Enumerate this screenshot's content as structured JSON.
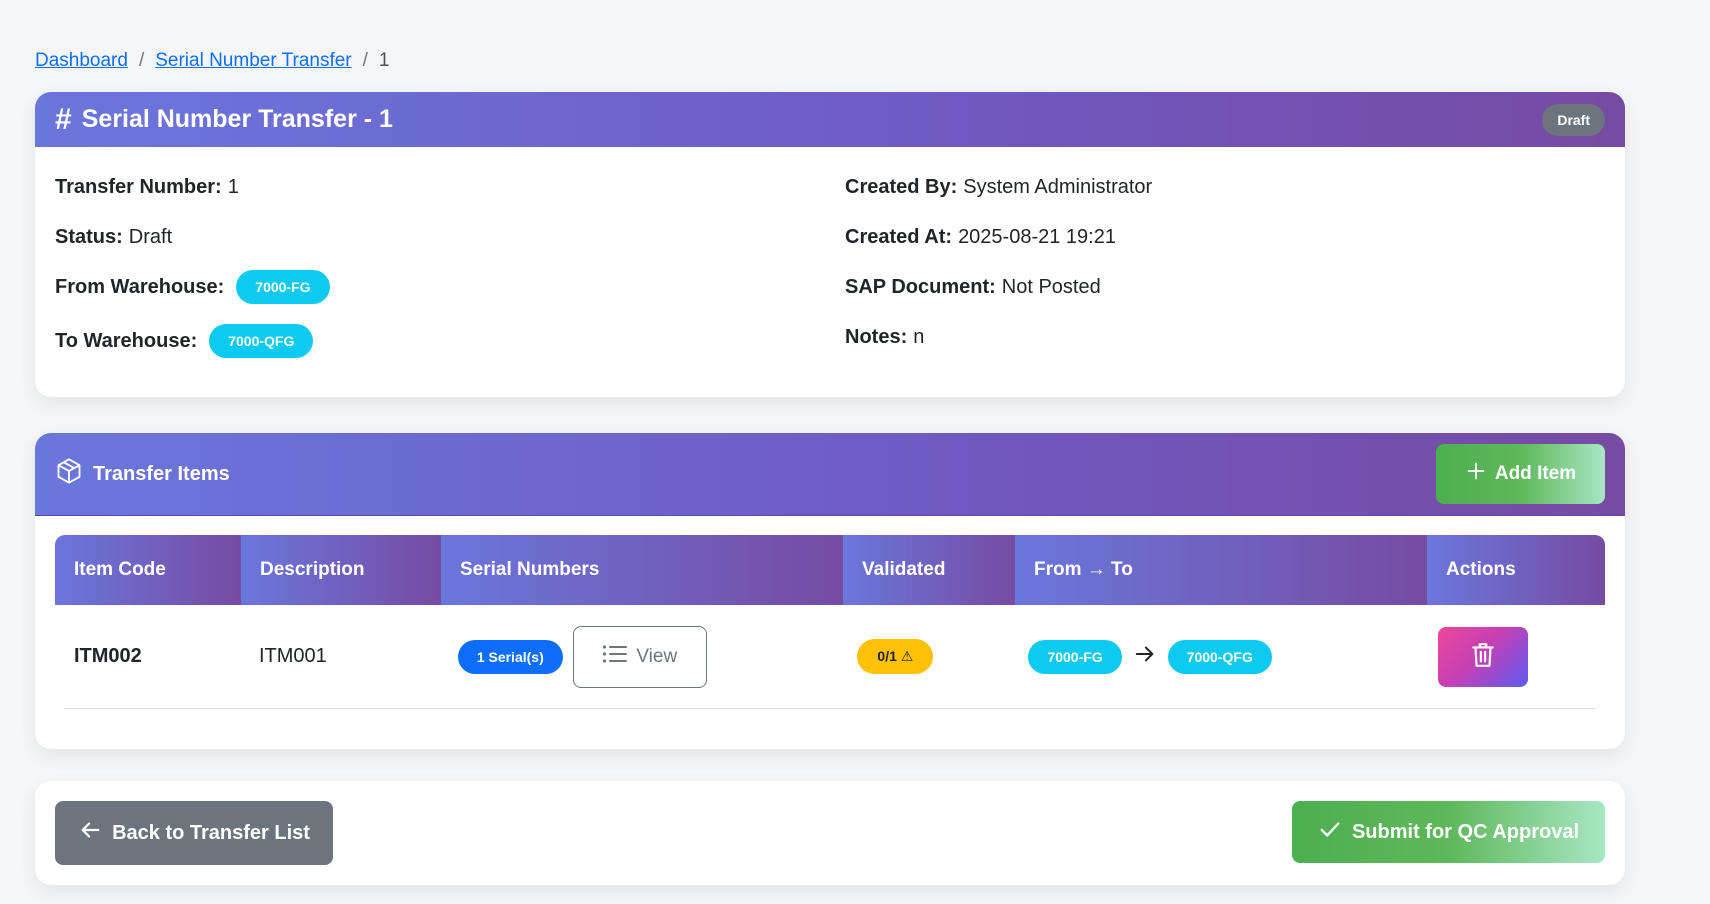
{
  "breadcrumb": {
    "items": [
      "Dashboard",
      "Serial Number Transfer"
    ],
    "current": "1",
    "separator": "/"
  },
  "transfer_card": {
    "title": "Serial Number Transfer - 1",
    "status_badge": "Draft",
    "left": {
      "transfer_number_label": "Transfer Number:",
      "transfer_number_value": "1",
      "status_label": "Status:",
      "status_value": "Draft",
      "from_label": "From Warehouse:",
      "from_value": "7000-FG",
      "to_label": "To Warehouse:",
      "to_value": "7000-QFG"
    },
    "right": {
      "created_by_label": "Created By:",
      "created_by_value": "System Administrator",
      "created_at_label": "Created At:",
      "created_at_value": "2025-08-21 19:21",
      "sap_label": "SAP Document:",
      "sap_value": "Not Posted",
      "notes_label": "Notes:",
      "notes_value": "n"
    }
  },
  "items_card": {
    "title": "Transfer Items",
    "add_button": "Add Item",
    "columns": [
      "Item Code",
      "Description",
      "Serial Numbers",
      "Validated",
      "From → To",
      "Actions"
    ],
    "rows": [
      {
        "item_code": "ITM002",
        "description": "ITM001",
        "serial_count": "1 Serial(s)",
        "view_label": "View",
        "validated": "0/1 ⚠",
        "from": "7000-FG",
        "to": "7000-QFG"
      }
    ]
  },
  "actions": {
    "back_button": "Back to Transfer List",
    "submit_button": "Submit for QC Approval"
  },
  "icons": {
    "title_icon": "hash-icon",
    "items_icon": "box-icon",
    "add_icon": "plus-icon",
    "view_icon": "list-icon",
    "arrow_icon": "arrow-right-icon",
    "delete_icon": "trash-icon",
    "back_icon": "arrow-left-icon",
    "submit_icon": "check-icon"
  },
  "colors": {
    "header_gradient_start": "#6a77dc",
    "header_gradient_end": "#764ba2",
    "warehouse_pill": "#0dcaf0",
    "serial_pill": "#0d6efd",
    "warning_pill": "#ffc107",
    "success": "#4caf50",
    "secondary": "#6c757d"
  }
}
